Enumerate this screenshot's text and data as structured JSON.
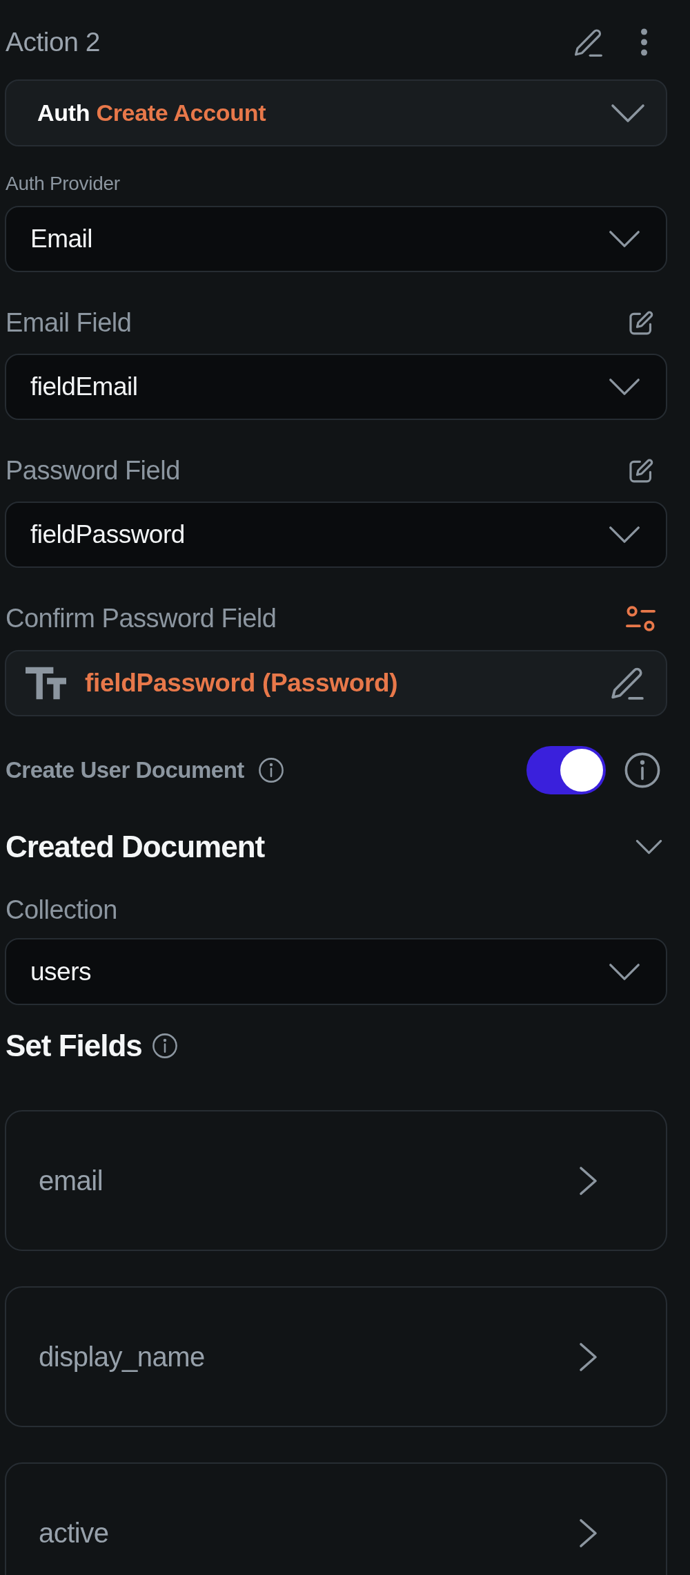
{
  "action": {
    "title": "Action 2",
    "category": "Auth",
    "name": "Create Account"
  },
  "auth_provider": {
    "label": "Auth Provider",
    "value": "Email"
  },
  "field_pickers": [
    {
      "label": "Email Field",
      "value": "fieldEmail"
    },
    {
      "label": "Password Field",
      "value": "fieldPassword"
    }
  ],
  "confirm_password_field": {
    "label": "Confirm Password Field",
    "value": "fieldPassword (Password)"
  },
  "create_user_document": {
    "label": "Create User Document",
    "on": true
  },
  "created_document": {
    "title": "Created Document",
    "expanded": true,
    "collection": {
      "label": "Collection",
      "value": "users"
    },
    "set_fields": {
      "title": "Set Fields",
      "fields": [
        {
          "name": "email"
        },
        {
          "name": "display_name"
        },
        {
          "name": "active"
        }
      ]
    }
  }
}
